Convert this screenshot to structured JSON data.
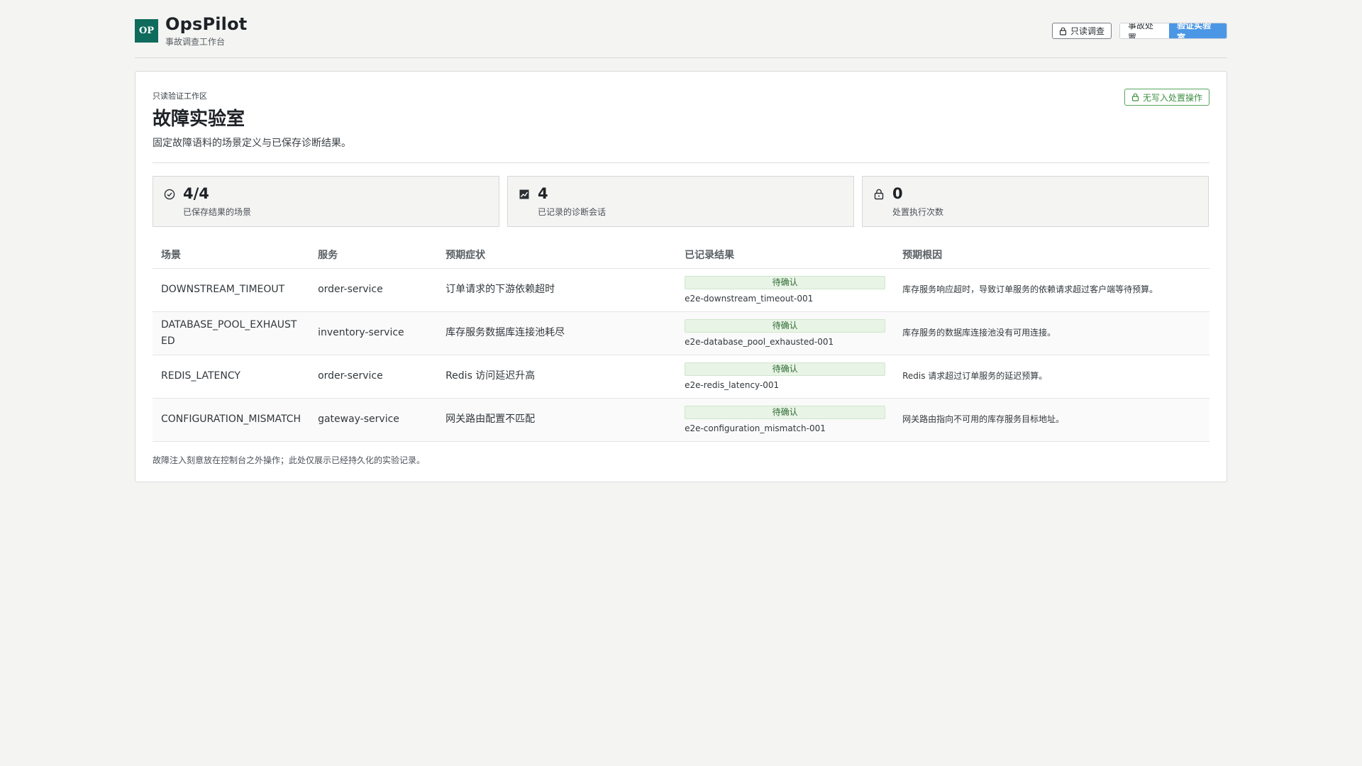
{
  "header": {
    "logo_text": "OP",
    "brand_name": "OpsPilot",
    "brand_subtitle": "事故调查工作台",
    "readonly_label": "只读调查",
    "nav_tabs": [
      {
        "label": "事故处置",
        "active": false
      },
      {
        "label": "验证实验室",
        "active": true
      }
    ]
  },
  "card": {
    "eyebrow": "只读验证工作区",
    "title": "故障实验室",
    "subtitle": "固定故障语料的场景定义与已保存诊断结果。",
    "nowrite_label": "无写入处置操作"
  },
  "stats": [
    {
      "value": "4/4",
      "label": "已保存结果的场景",
      "icon": "check-circle-icon"
    },
    {
      "value": "4",
      "label": "已记录的诊断会话",
      "icon": "trend-chart-icon"
    },
    {
      "value": "0",
      "label": "处置执行次数",
      "icon": "lock-icon"
    }
  ],
  "table": {
    "headers": [
      "场景",
      "服务",
      "预期症状",
      "已记录结果",
      "预期根因"
    ],
    "rows": [
      {
        "scenario": "DOWNSTREAM_TIMEOUT",
        "service": "order-service",
        "symptom": "订单请求的下游依赖超时",
        "status": "待确认",
        "result_id": "e2e-downstream_timeout-001",
        "root_cause": "库存服务响应超时，导致订单服务的依赖请求超过客户端等待预算。"
      },
      {
        "scenario": "DATABASE_POOL_EXHAUSTED",
        "service": "inventory-service",
        "symptom": "库存服务数据库连接池耗尽",
        "status": "待确认",
        "result_id": "e2e-database_pool_exhausted-001",
        "root_cause": "库存服务的数据库连接池没有可用连接。"
      },
      {
        "scenario": "REDIS_LATENCY",
        "service": "order-service",
        "symptom": "Redis 访问延迟升高",
        "status": "待确认",
        "result_id": "e2e-redis_latency-001",
        "root_cause": "Redis 请求超过订单服务的延迟预算。"
      },
      {
        "scenario": "CONFIGURATION_MISMATCH",
        "service": "gateway-service",
        "symptom": "网关路由配置不匹配",
        "status": "待确认",
        "result_id": "e2e-configuration_mismatch-001",
        "root_cause": "网关路由指向不可用的库存服务目标地址。"
      }
    ]
  },
  "footnote": "故障注入刻意放在控制台之外操作；此处仅展示已经持久化的实验记录。",
  "colors": {
    "brand": "#0f6b5b",
    "accent": "#4b97e6",
    "success": "#3d8f42",
    "badge_bg": "#e8f4e6"
  }
}
